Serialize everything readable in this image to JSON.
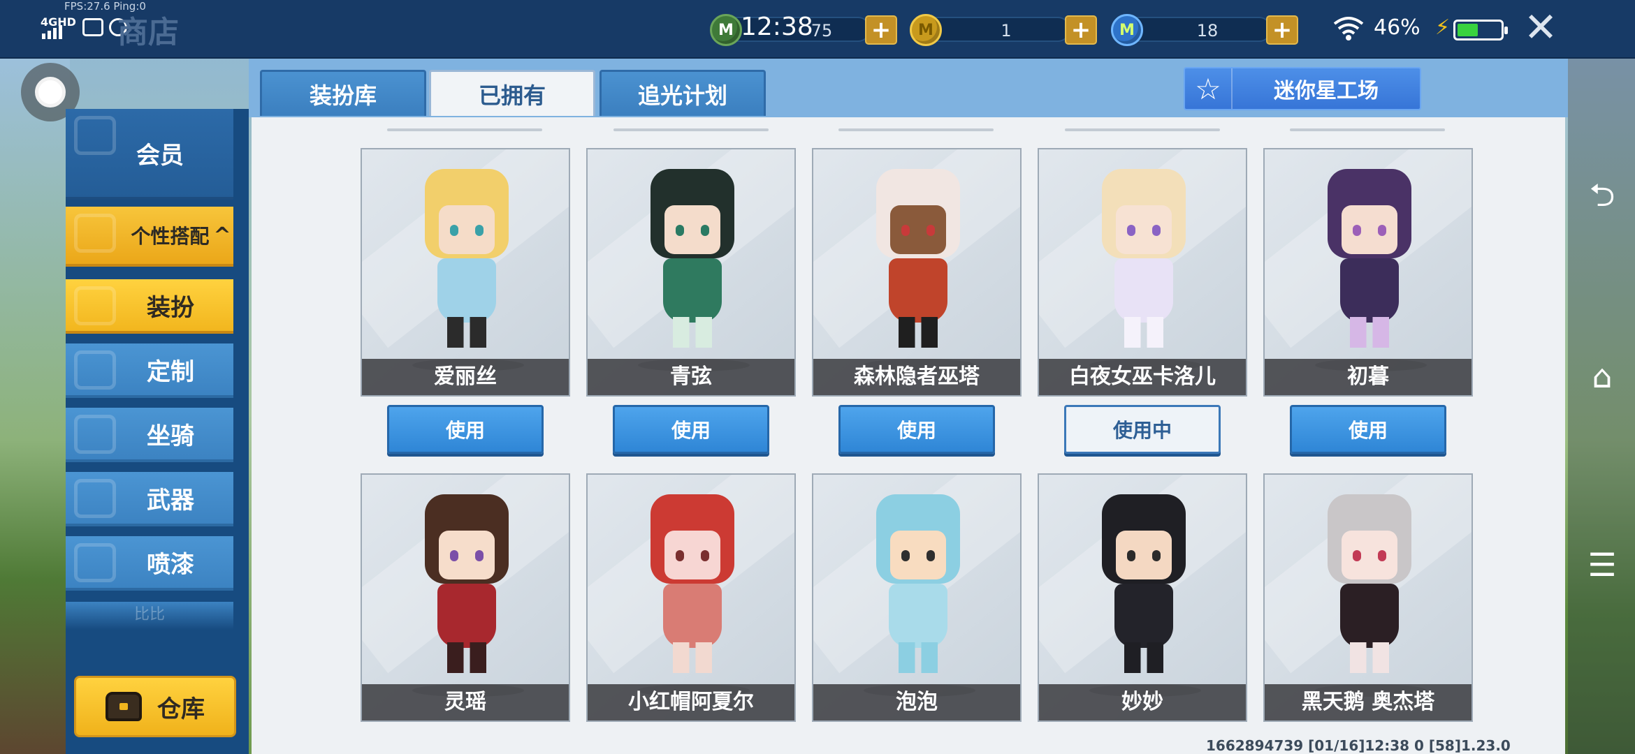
{
  "status": {
    "fps": "FPS:27.6  Ping:0",
    "network": "4GHD",
    "clock": "12:38",
    "battery_percent": "46%",
    "battery_level": 0.46
  },
  "header": {
    "shop_title": "商店",
    "currencies": [
      {
        "icon": "mini-bean-icon",
        "value": "75",
        "color": "#3f7a39"
      },
      {
        "icon": "mini-coin-icon",
        "value": "1",
        "color": "#c89a1d"
      },
      {
        "icon": "mini-point-icon",
        "value": "18",
        "color": "#2e73c9"
      }
    ],
    "add_label": "+",
    "close_label": "✕"
  },
  "sidebar": {
    "member": "会员",
    "group": "个性搭配",
    "group_arrow": "^",
    "items": [
      "装扮",
      "定制",
      "坐骑",
      "武器",
      "喷漆"
    ],
    "faded_item": "比比",
    "warehouse": "仓库"
  },
  "tabs": [
    "装扮库",
    "已拥有",
    "追光计划"
  ],
  "active_tab": "已拥有",
  "workshop_button": "迷你星工场",
  "skins": [
    {
      "name": "爱丽丝",
      "action": "使用",
      "in_use": false,
      "hair": "#f2cf6b",
      "skin": "#f5dcc8",
      "eye": "#3aa1a8",
      "cloth": "#9fd2e8",
      "leg": "#2b2b2b"
    },
    {
      "name": "青弦",
      "action": "使用",
      "in_use": false,
      "hair": "#22302c",
      "skin": "#f4dccb",
      "eye": "#2a7a63",
      "cloth": "#2f7a5f",
      "leg": "#d8ece0"
    },
    {
      "name": "森林隐者巫塔",
      "action": "使用",
      "in_use": false,
      "hair": "#f1e6e2",
      "skin": "#8a5a3b",
      "eye": "#c83a3a",
      "cloth": "#c0442b",
      "leg": "#1f1f1f"
    },
    {
      "name": "白夜女巫卡洛儿",
      "action": "使用中",
      "in_use": true,
      "hair": "#f3dfb9",
      "skin": "#f7e2d3",
      "eye": "#8a63c4",
      "cloth": "#e8e2f6",
      "leg": "#f5f2fb"
    },
    {
      "name": "初暮",
      "action": "使用",
      "in_use": false,
      "hair": "#4a3266",
      "skin": "#f5ddd0",
      "eye": "#9c5fb8",
      "cloth": "#3c2d5a",
      "leg": "#d6b7e6"
    },
    {
      "name": "灵瑶",
      "action": "",
      "in_use": false,
      "hair": "#4b2e22",
      "skin": "#f6ddcb",
      "eye": "#7b4fa8",
      "cloth": "#a8282e",
      "leg": "#3a1e1e"
    },
    {
      "name": "小红帽阿夏尔",
      "action": "",
      "in_use": false,
      "hair": "#cc3a33",
      "skin": "#f7d6d3",
      "eye": "#7a2f2f",
      "cloth": "#d97c74",
      "leg": "#f2d9d0"
    },
    {
      "name": "泡泡",
      "action": "",
      "in_use": false,
      "hair": "#8ccfe2",
      "skin": "#f8dcc0",
      "eye": "#2f2f2f",
      "cloth": "#a9dbea",
      "leg": "#8ccfe2"
    },
    {
      "name": "妙妙",
      "action": "",
      "in_use": false,
      "hair": "#1f1f24",
      "skin": "#f4d8c2",
      "eye": "#2b2b2b",
      "cloth": "#23232a",
      "leg": "#1f1f24"
    },
    {
      "name": "黑天鹅 奥杰塔",
      "action": "",
      "in_use": false,
      "hair": "#c9c6c8",
      "skin": "#f7e3dd",
      "eye": "#c23a55",
      "cloth": "#2b1f24",
      "leg": "#f1e3e3"
    }
  ],
  "footer_id": "1662894739  [01/16]12:38 0   [58]1.23.0"
}
